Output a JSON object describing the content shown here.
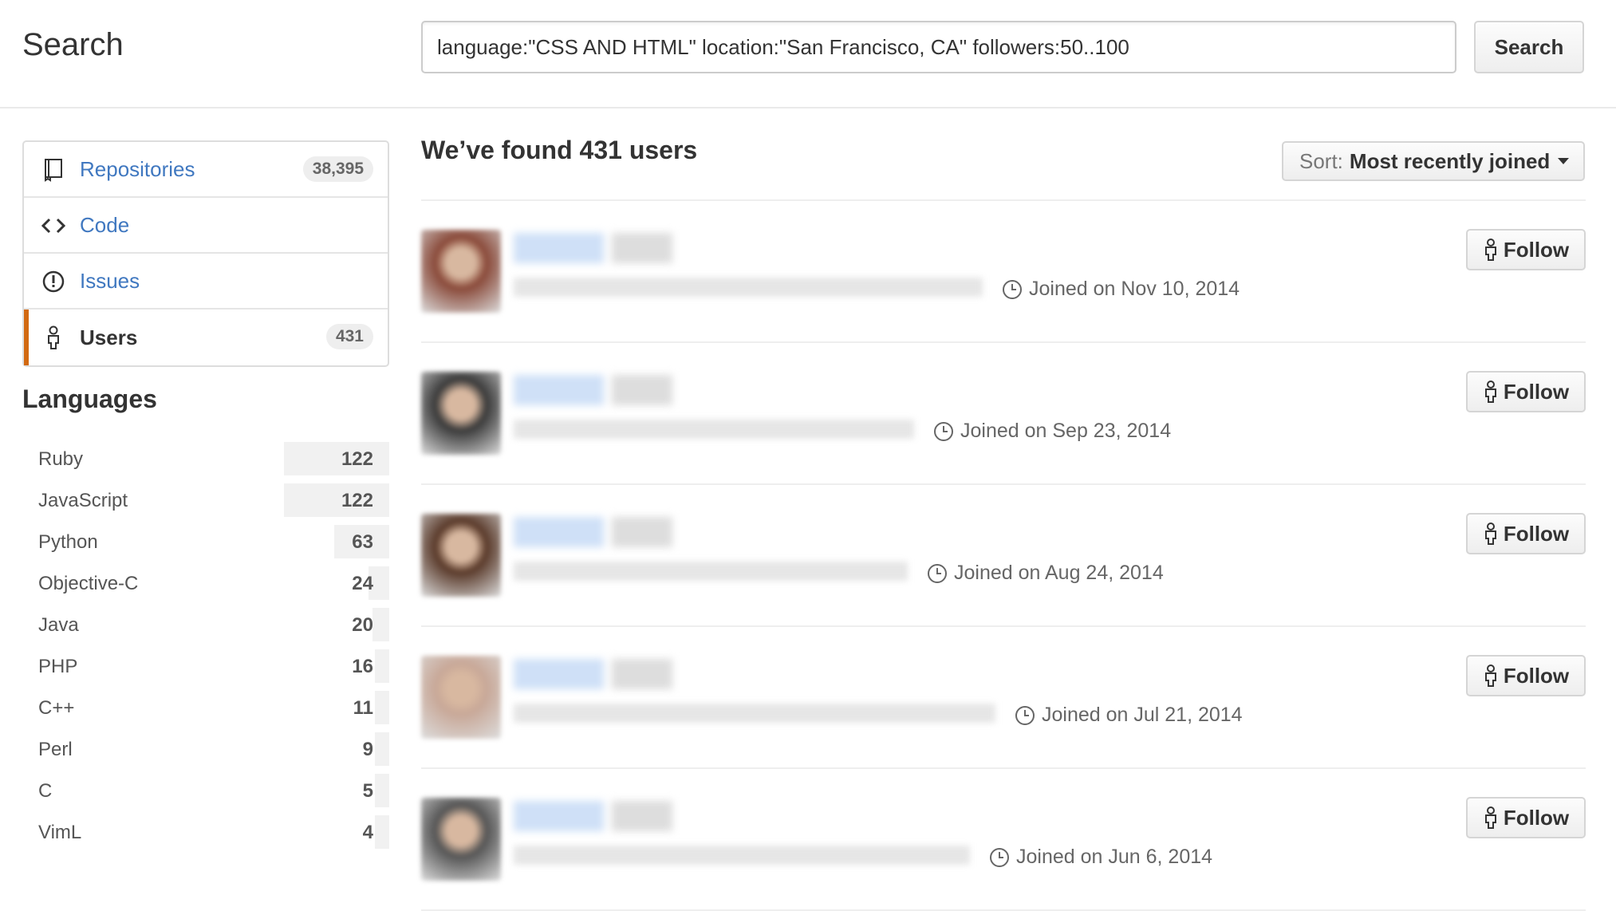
{
  "header": {
    "title": "Search",
    "query": "language:\"CSS AND HTML\" location:\"San Francisco, CA\" followers:50..100",
    "search_button": "Search"
  },
  "nav": [
    {
      "label": "Repositories",
      "count": "38,395",
      "icon": "repo-icon"
    },
    {
      "label": "Code",
      "count": "",
      "icon": "code-icon"
    },
    {
      "label": "Issues",
      "count": "",
      "icon": "issue-icon"
    },
    {
      "label": "Users",
      "count": "431",
      "icon": "person-icon",
      "selected": true
    }
  ],
  "languages": {
    "title": "Languages",
    "items": [
      {
        "name": "Ruby",
        "count": "122",
        "share": 1.0
      },
      {
        "name": "JavaScript",
        "count": "122",
        "share": 1.0
      },
      {
        "name": "Python",
        "count": "63",
        "share": 0.52
      },
      {
        "name": "Objective-C",
        "count": "24",
        "share": 0.2
      },
      {
        "name": "Java",
        "count": "20",
        "share": 0.16
      },
      {
        "name": "PHP",
        "count": "16",
        "share": 0.13
      },
      {
        "name": "C++",
        "count": "11",
        "share": 0.09
      },
      {
        "name": "Perl",
        "count": "9",
        "share": 0.07
      },
      {
        "name": "C",
        "count": "5",
        "share": 0.04
      },
      {
        "name": "VimL",
        "count": "4",
        "share": 0.03
      }
    ]
  },
  "results": {
    "title": "We’ve found 431 users",
    "sort_label": "Sort:",
    "sort_value": "Most recently joined",
    "follow_label": "Follow",
    "users": [
      {
        "joined": "Joined on Nov 10, 2014",
        "avatar_color": "#8a4a3a"
      },
      {
        "joined": "Joined on Sep 23, 2014",
        "avatar_color": "#3a3a3a"
      },
      {
        "joined": "Joined on Aug 24, 2014",
        "avatar_color": "#5a3a2a"
      },
      {
        "joined": "Joined on Jul 21, 2014",
        "avatar_color": "#c8a898"
      },
      {
        "joined": "Joined on Jun 6, 2014",
        "avatar_color": "#555555"
      }
    ]
  }
}
